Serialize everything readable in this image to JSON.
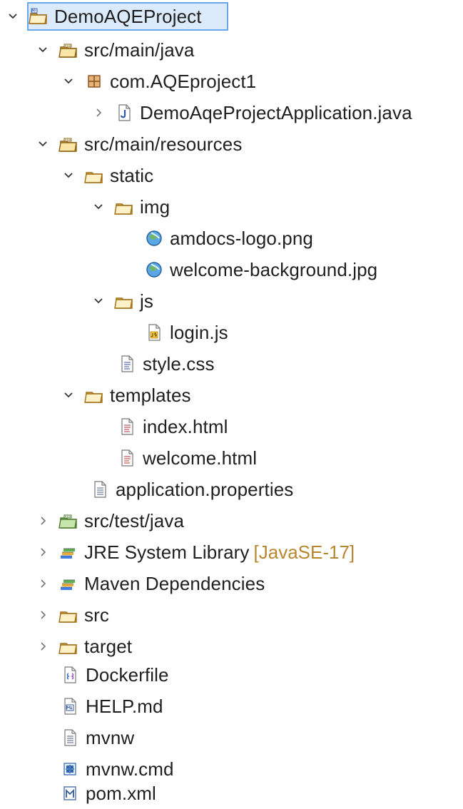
{
  "tree": {
    "root": {
      "label": "DemoAQEProject"
    },
    "items": [
      {
        "label": "src/main/java",
        "icon": "source-folder-icon"
      },
      {
        "label": "com.AQEproject1",
        "icon": "package-icon"
      },
      {
        "label": "DemoAqeProjectApplication.java",
        "icon": "java-file-icon"
      },
      {
        "label": "src/main/resources",
        "icon": "source-folder-icon"
      },
      {
        "label": "static",
        "icon": "folder-icon"
      },
      {
        "label": "img",
        "icon": "folder-icon"
      },
      {
        "label": "amdocs-logo.png",
        "icon": "image-file-icon"
      },
      {
        "label": "welcome-background.jpg",
        "icon": "image-file-icon"
      },
      {
        "label": "js",
        "icon": "folder-icon"
      },
      {
        "label": "login.js",
        "icon": "javascript-file-icon"
      },
      {
        "label": "style.css",
        "icon": "css-file-icon"
      },
      {
        "label": "templates",
        "icon": "folder-icon"
      },
      {
        "label": "index.html",
        "icon": "html-file-icon"
      },
      {
        "label": "welcome.html",
        "icon": "html-file-icon"
      },
      {
        "label": "application.properties",
        "icon": "properties-file-icon"
      },
      {
        "label": "src/test/java",
        "icon": "source-folder-icon"
      },
      {
        "label": "JRE System Library",
        "decor": "[JavaSE-17]",
        "icon": "library-icon"
      },
      {
        "label": "Maven Dependencies",
        "icon": "library-icon"
      },
      {
        "label": "src",
        "icon": "folder-icon"
      },
      {
        "label": "target",
        "icon": "folder-icon"
      },
      {
        "label": "Dockerfile",
        "icon": "dockerfile-icon"
      },
      {
        "label": "HELP.md",
        "icon": "markdown-file-icon"
      },
      {
        "label": "mvnw",
        "icon": "text-file-icon"
      },
      {
        "label": "mvnw.cmd",
        "icon": "windows-command-file-icon"
      },
      {
        "label": "pom.xml",
        "icon": "maven-pom-file-icon"
      }
    ]
  }
}
